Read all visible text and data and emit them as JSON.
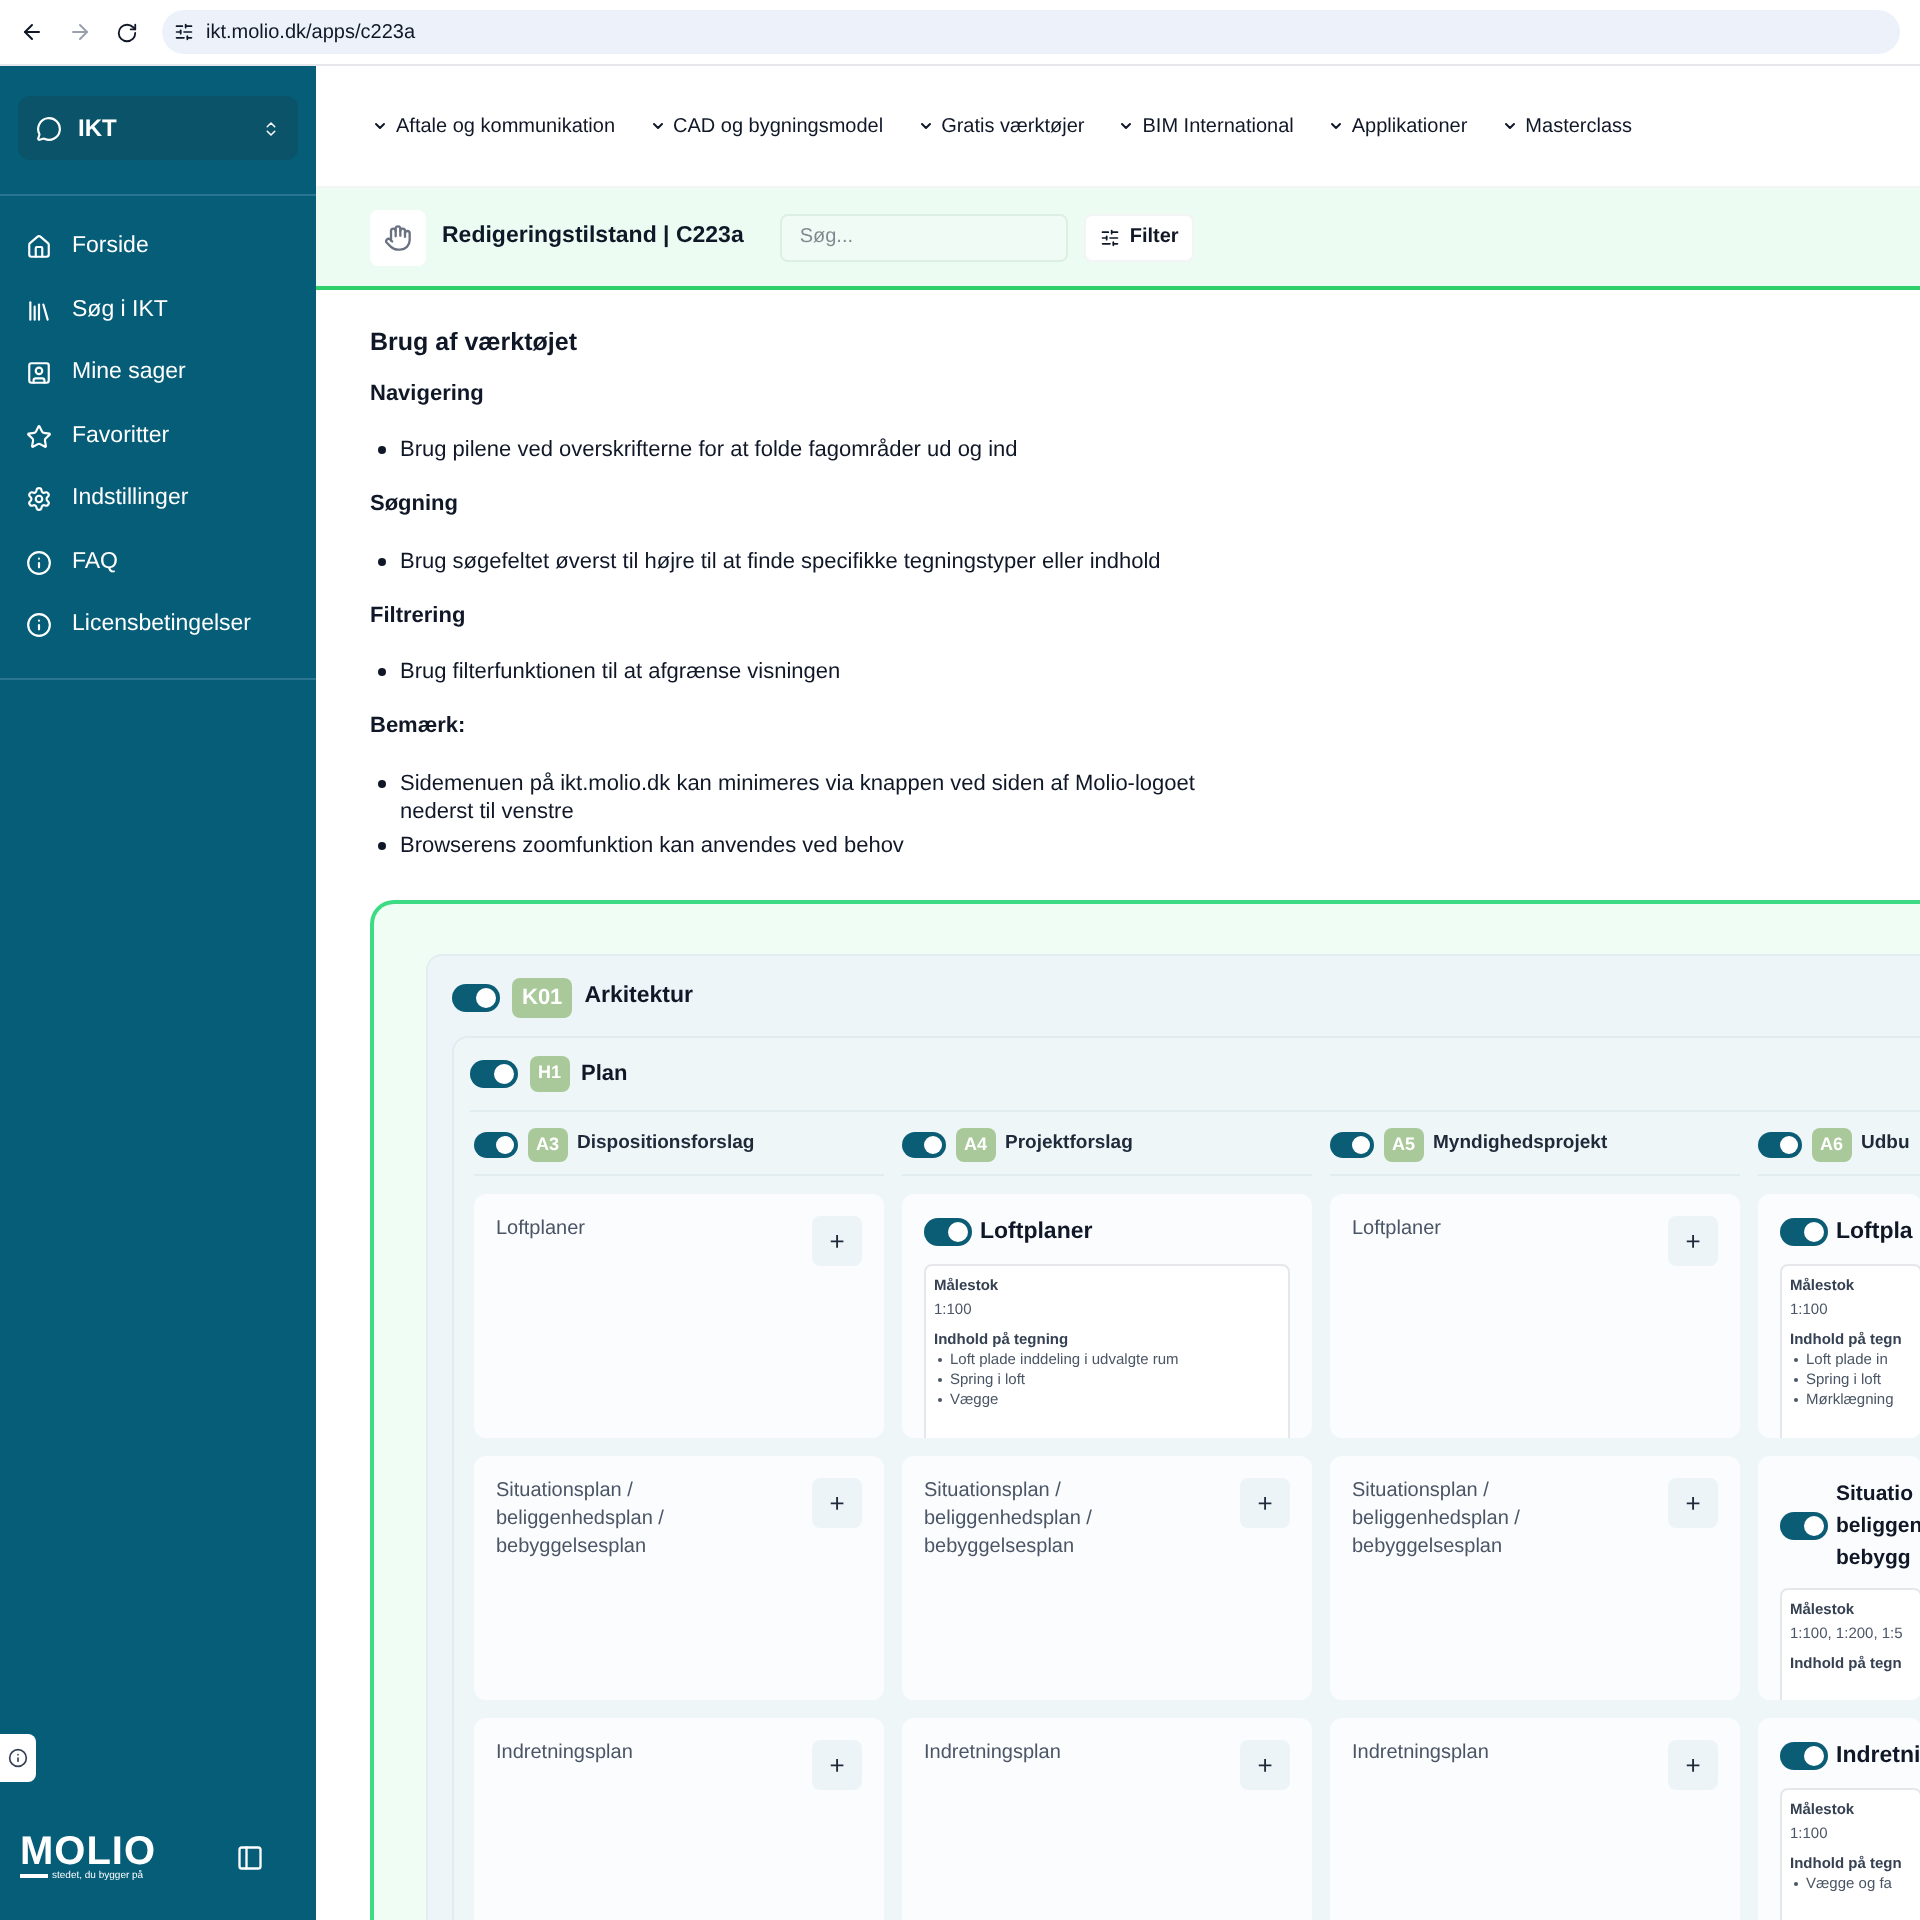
{
  "browser": {
    "url": "ikt.molio.dk/apps/c223a"
  },
  "sidebar": {
    "app": "IKT",
    "items": [
      {
        "label": "Forside"
      },
      {
        "label": "Søg i IKT"
      },
      {
        "label": "Mine sager"
      },
      {
        "label": "Favoritter"
      },
      {
        "label": "Indstillinger"
      },
      {
        "label": "FAQ"
      },
      {
        "label": "Licensbetingelser"
      }
    ],
    "logo": "MOLIO",
    "tagline": "stedet, du bygger på"
  },
  "nav": [
    "Aftale og kommunikation",
    "CAD og bygningsmodel",
    "Gratis værktøjer",
    "BIM International",
    "Applikationer",
    "Masterclass"
  ],
  "header": {
    "title": "Redigeringstilstand | C223a",
    "search_placeholder": "Søg...",
    "filter": "Filter"
  },
  "guide": {
    "title": "Brug af værktøjet",
    "sections": [
      {
        "heading": "Navigering",
        "bullets": [
          "Brug pilene ved overskrifterne for at folde fagområder ud og ind"
        ]
      },
      {
        "heading": "Søgning",
        "bullets": [
          "Brug søgefeltet øverst til højre til at finde specifikke tegningstyper eller indhold"
        ]
      },
      {
        "heading": "Filtrering",
        "bullets": [
          "Brug filterfunktionen til at afgrænse visningen"
        ]
      },
      {
        "heading": "Bemærk:",
        "bullets": [
          "Sidemenuen på ikt.molio.dk kan minimeres via knappen ved siden af Molio-logoet nederst til venstre",
          "Browserens zoomfunktion kan anvendes ved behov"
        ]
      }
    ]
  },
  "discipline": {
    "code": "K01",
    "name": "Arkitektur",
    "on": true,
    "group": {
      "code": "H1",
      "name": "Plan",
      "on": true,
      "phases": [
        {
          "code": "A3",
          "name": "Dispositionsforslag",
          "on": true,
          "cards": [
            {
              "kind": "empty",
              "title": "Loftplaner",
              "add": "+"
            },
            {
              "kind": "empty",
              "title": "Situationsplan / beliggenhedsplan / bebyggelsesplan",
              "add": "+"
            },
            {
              "kind": "empty",
              "title": "Indretningsplan",
              "add": "+"
            }
          ]
        },
        {
          "code": "A4",
          "name": "Projektforslag",
          "on": true,
          "cards": [
            {
              "kind": "detail",
              "on": true,
              "title": "Loftplaner",
              "scale_label": "Målestok",
              "scale": "1:100",
              "content_label": "Indhold på tegning",
              "items": [
                "Loft plade inddeling i udvalgte rum",
                "Spring i loft",
                "Vægge"
              ]
            },
            {
              "kind": "empty",
              "title": "Situationsplan / beliggenhedsplan / bebyggelsesplan",
              "add": "+"
            },
            {
              "kind": "empty",
              "title": "Indretningsplan",
              "add": "+"
            }
          ]
        },
        {
          "code": "A5",
          "name": "Myndighedsprojekt",
          "on": true,
          "cards": [
            {
              "kind": "empty",
              "title": "Loftplaner",
              "add": "+"
            },
            {
              "kind": "empty",
              "title": "Situationsplan / beliggenhedsplan / bebyggelsesplan",
              "add": "+"
            },
            {
              "kind": "empty",
              "title": "Indretningsplan",
              "add": "+"
            }
          ]
        },
        {
          "code": "A6",
          "name": "Udbu",
          "on": true,
          "cards": [
            {
              "kind": "detail",
              "on": true,
              "title": "Loftpla",
              "scale_label": "Målestok",
              "scale": "1:100",
              "content_label": "Indhold på tegn",
              "items": [
                "Loft plade in",
                "Spring i loft",
                "Mørklægning"
              ]
            },
            {
              "kind": "detail",
              "on": true,
              "title_lines": [
                "Situatio",
                "beliggen",
                "bebygg"
              ],
              "scale_label": "Målestok",
              "scale": "1:100, 1:200, 1:5",
              "content_label": "Indhold på tegn"
            },
            {
              "kind": "detail",
              "on": true,
              "title": "Indretni",
              "scale_label": "Målestok",
              "scale": "1:100",
              "content_label": "Indhold på tegn",
              "items": [
                "Vægge og fa"
              ]
            }
          ]
        }
      ]
    }
  }
}
